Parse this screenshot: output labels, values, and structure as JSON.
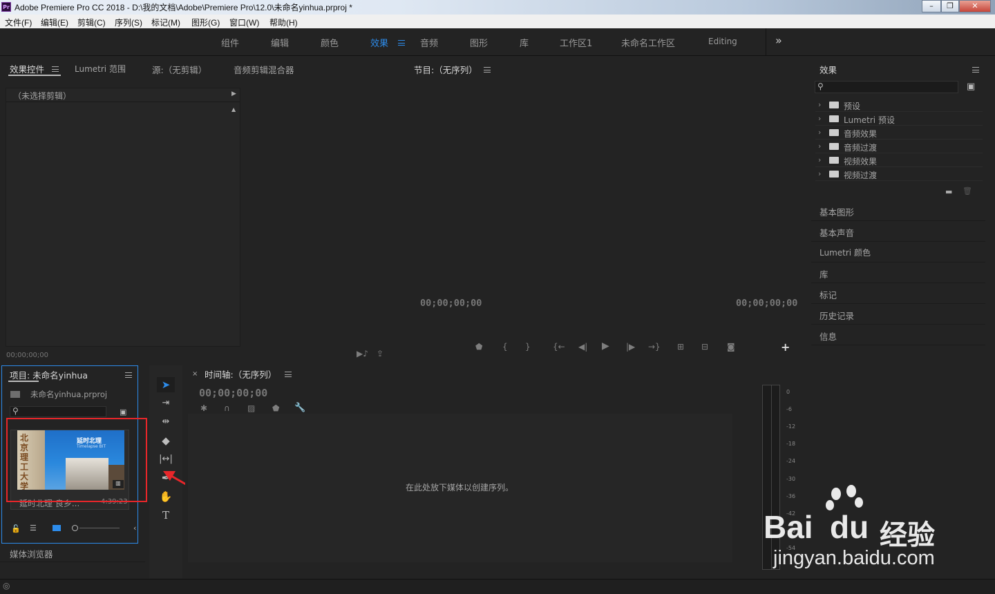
{
  "titlebar": {
    "app_icon": "Pr",
    "title": "Adobe Premiere Pro CC 2018 - D:\\我的文档\\Adobe\\Premiere Pro\\12.0\\未命名yinhua.prproj *"
  },
  "menu": [
    "文件(F)",
    "编辑(E)",
    "剪辑(C)",
    "序列(S)",
    "标记(M)",
    "图形(G)",
    "窗口(W)",
    "帮助(H)"
  ],
  "workspaces": [
    "组件",
    "编辑",
    "颜色",
    "效果",
    "音频",
    "图形",
    "库",
    "工作区1",
    "未命名工作区",
    "Editing"
  ],
  "active_workspace": "效果",
  "source_panel": {
    "tabs": [
      "效果控件",
      "Lumetri 范围",
      "源:（无剪辑）",
      "音频剪辑混合器"
    ],
    "no_clip": "（未选择剪辑）",
    "timecode": "00;00;00;00"
  },
  "program_panel": {
    "tab": "节目:（无序列）",
    "timecode_left": "00;00;00;00",
    "timecode_right": "00;00;00;00"
  },
  "effects_panel": {
    "title": "效果",
    "folders": [
      "预设",
      "Lumetri 预设",
      "音频效果",
      "音频过渡",
      "视频效果",
      "视频过渡"
    ]
  },
  "side_panels": [
    "基本图形",
    "基本声音",
    "Lumetri 颜色",
    "库",
    "标记",
    "历史记录",
    "信息"
  ],
  "project_panel": {
    "title": "项目: 未命名yinhua",
    "file": "未命名yinhua.prproj",
    "clip_name": "延时北理 良乡...",
    "clip_duration": "4:39:23",
    "thumb_text": "延时北理",
    "thumb_sub": "Timelapse BIT",
    "media_browser": "媒体浏览器"
  },
  "timeline_panel": {
    "tab": "时间轴:（无序列）",
    "timecode": "00;00;00;00",
    "drop_hint": "在此处放下媒体以创建序列。"
  },
  "meter_ticks": [
    "0",
    "-6",
    "-12",
    "-18",
    "-24",
    "-30",
    "-36",
    "-42",
    "-48",
    "-54"
  ],
  "watermark": {
    "brand": "Bai",
    "brand2": "du",
    "cn": "经验",
    "url": "jingyan.baidu.com"
  },
  "colors": {
    "accent": "#2d8ceb",
    "highlight_box": "#e8262a",
    "panel_focus": "#2d8ceb"
  }
}
